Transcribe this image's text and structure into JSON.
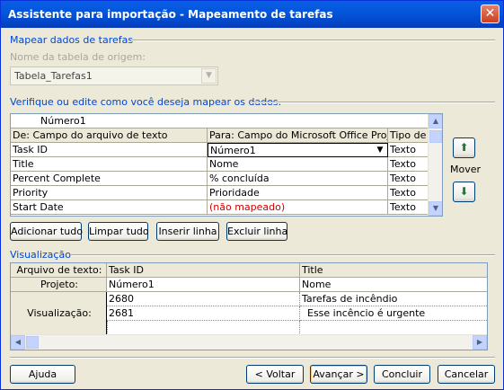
{
  "window": {
    "title": "Assistente para importação - Mapeamento de tarefas",
    "close_glyph": "✕"
  },
  "map_section": {
    "title": "Mapear dados de tarefas",
    "source_table_label": "Nome da tabela de origem:",
    "source_table_value": "Tabela_Tarefas1"
  },
  "verify_text": "Verifique ou edite como você deseja mapear os dados.",
  "mapping_grid": {
    "edit_value": "Número1",
    "headers": [
      "De: Campo do arquivo de texto",
      "Para: Campo do Microsoft Office Project",
      "Tipo de d"
    ],
    "rows": [
      {
        "from": "Task ID",
        "to": "Número1",
        "type": "Texto"
      },
      {
        "from": "Title",
        "to": "Nome",
        "type": "Texto"
      },
      {
        "from": "Percent Complete",
        "to": "% concluída",
        "type": "Texto"
      },
      {
        "from": "Priority",
        "to": "Prioridade",
        "type": "Texto"
      },
      {
        "from": "Start Date",
        "to": "(não mapeado)",
        "type": "Texto"
      }
    ]
  },
  "mover_label": "Mover",
  "grid_buttons": {
    "add_all": "Adicionar tudo",
    "clear_all": "Limpar tudo",
    "insert_row": "Inserir linha",
    "delete_row": "Excluir linha"
  },
  "preview": {
    "title": "Visualização",
    "row_labels": {
      "text_file": "Arquivo de texto:",
      "project": "Projeto:",
      "preview": "Visualização:"
    },
    "columns": [
      {
        "text_file": "Task ID",
        "project": "Número1",
        "values": [
          "2680",
          "2681"
        ]
      },
      {
        "text_file": "Title",
        "project": "Nome",
        "values": [
          "Tarefas de incêndio",
          "Esse incêncio é urgente"
        ]
      }
    ]
  },
  "footer": {
    "help": "Ajuda",
    "back": "< Voltar",
    "next": "Avançar >",
    "finish": "Concluir",
    "cancel": "Cancelar"
  },
  "colors": {
    "title_bar": "#0355DA",
    "section_title": "#0046D5",
    "unmapped_text": "#D00000"
  }
}
